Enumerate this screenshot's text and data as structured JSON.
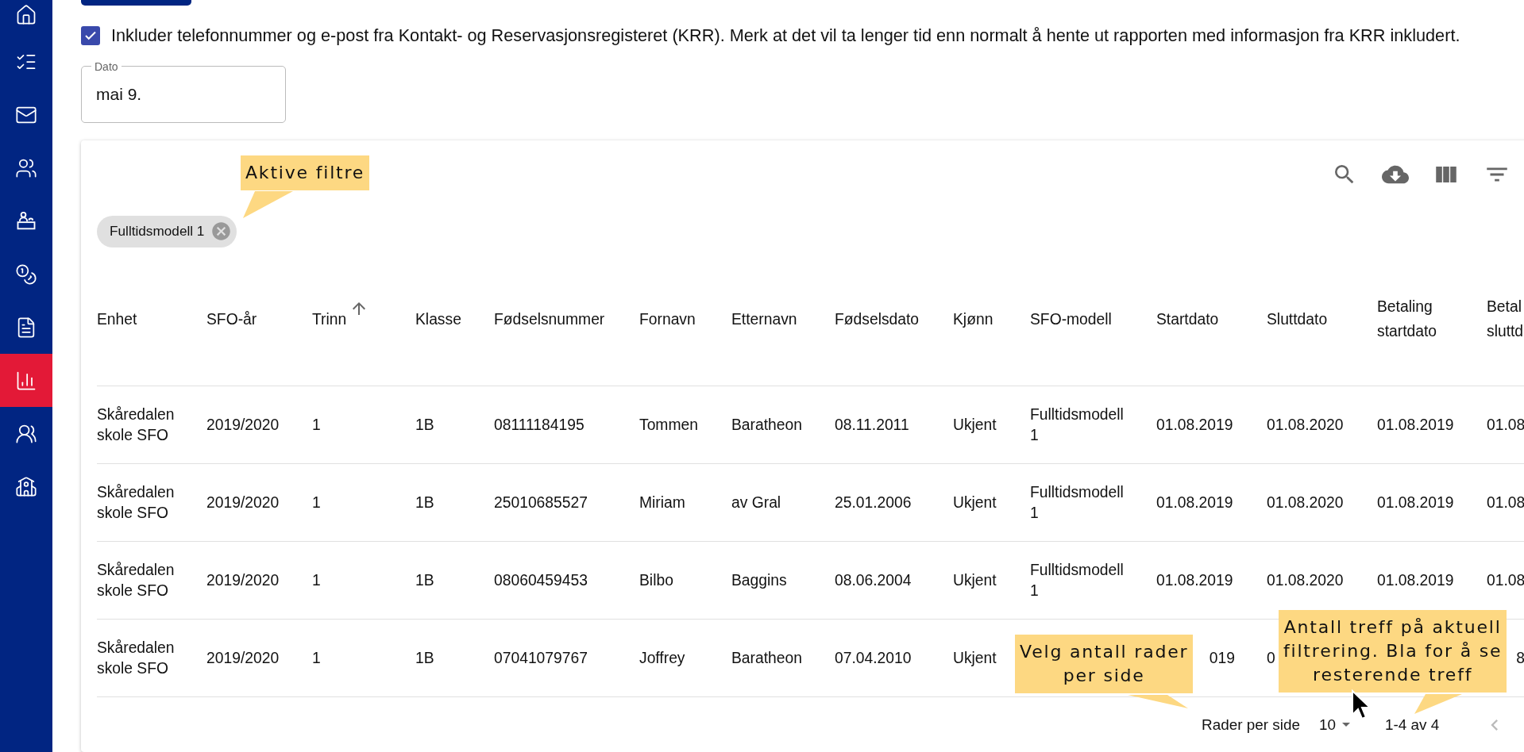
{
  "sidebar": {
    "items": [
      {
        "selected": false
      },
      {
        "selected": false
      },
      {
        "selected": false
      },
      {
        "selected": false
      },
      {
        "selected": false
      },
      {
        "selected": false
      },
      {
        "selected": false
      },
      {
        "selected": true
      },
      {
        "selected": false
      },
      {
        "selected": false
      }
    ]
  },
  "krr_checkbox": {
    "label": "Inkluder telefonnummer og e-post fra Kontakt- og Reservasjonsregisteret (KRR). Merk at det vil ta lenger tid enn normalt å hente ut rapporten med informasjon fra KRR inkludert.",
    "checked": true
  },
  "date_field": {
    "label": "Dato",
    "value": "mai 9."
  },
  "table": {
    "active_filters": [
      {
        "label": "Fulltidsmodell 1"
      }
    ],
    "columns": [
      {
        "label": "Enhet",
        "sorted": false
      },
      {
        "label": "SFO-år",
        "sorted": false
      },
      {
        "label": "Trinn",
        "sorted": true
      },
      {
        "label": "Klasse",
        "sorted": false
      },
      {
        "label": "Fødselsnummer",
        "sorted": false
      },
      {
        "label": "Fornavn",
        "sorted": false
      },
      {
        "label": "Etternavn",
        "sorted": false
      },
      {
        "label": "Fødselsdato",
        "sorted": false
      },
      {
        "label": "Kjønn",
        "sorted": false
      },
      {
        "label": "SFO-modell",
        "sorted": false
      },
      {
        "label": "Startdato",
        "sorted": false
      },
      {
        "label": "Sluttdato",
        "sorted": false
      },
      {
        "label": "Betaling startdato",
        "sorted": false
      },
      {
        "label": "Betal sluttd",
        "sorted": false
      }
    ],
    "rows": [
      {
        "cells": [
          "Skåredalen skole SFO",
          "2019/2020",
          "1",
          "1B",
          "08111184195",
          "Tommen",
          "Baratheon",
          "08.11.2011",
          "Ukjent",
          "Fulltidsmodell 1",
          "01.08.2019",
          "01.08.2020",
          "01.08.2019",
          "01.08"
        ]
      },
      {
        "cells": [
          "Skåredalen skole SFO",
          "2019/2020",
          "1",
          "1B",
          "25010685527",
          "Miriam",
          "av Gral",
          "25.01.2006",
          "Ukjent",
          "Fulltidsmodell 1",
          "01.08.2019",
          "01.08.2020",
          "01.08.2019",
          "01.08"
        ]
      },
      {
        "cells": [
          "Skåredalen skole SFO",
          "2019/2020",
          "1",
          "1B",
          "08060459453",
          "Bilbo",
          "Baggins",
          "08.06.2004",
          "Ukjent",
          "Fulltidsmodell 1",
          "01.08.2019",
          "01.08.2020",
          "01.08.2019",
          "01.08"
        ]
      },
      {
        "cells": [
          "Skåredalen skole SFO",
          "2019/2020",
          "1",
          "1B",
          "07041079767",
          "Joffrey",
          "Baratheon",
          "07.04.2010",
          "Ukjent",
          null,
          {
            "text": "019",
            "kind": "tail"
          },
          "0",
          null,
          {
            "text": "8",
            "kind": "tail"
          }
        ]
      }
    ],
    "footer": {
      "rows_per_page_label": "Rader per side",
      "rows_per_page": "10",
      "range": "1-4 av 4"
    }
  },
  "callouts": [
    {
      "text": "Aktive filtre"
    },
    {
      "text": "Velg antall rader\nper side"
    },
    {
      "text": "Antall treff på aktuell\nfiltrering. Bla for å se\nresterende treff"
    }
  ]
}
